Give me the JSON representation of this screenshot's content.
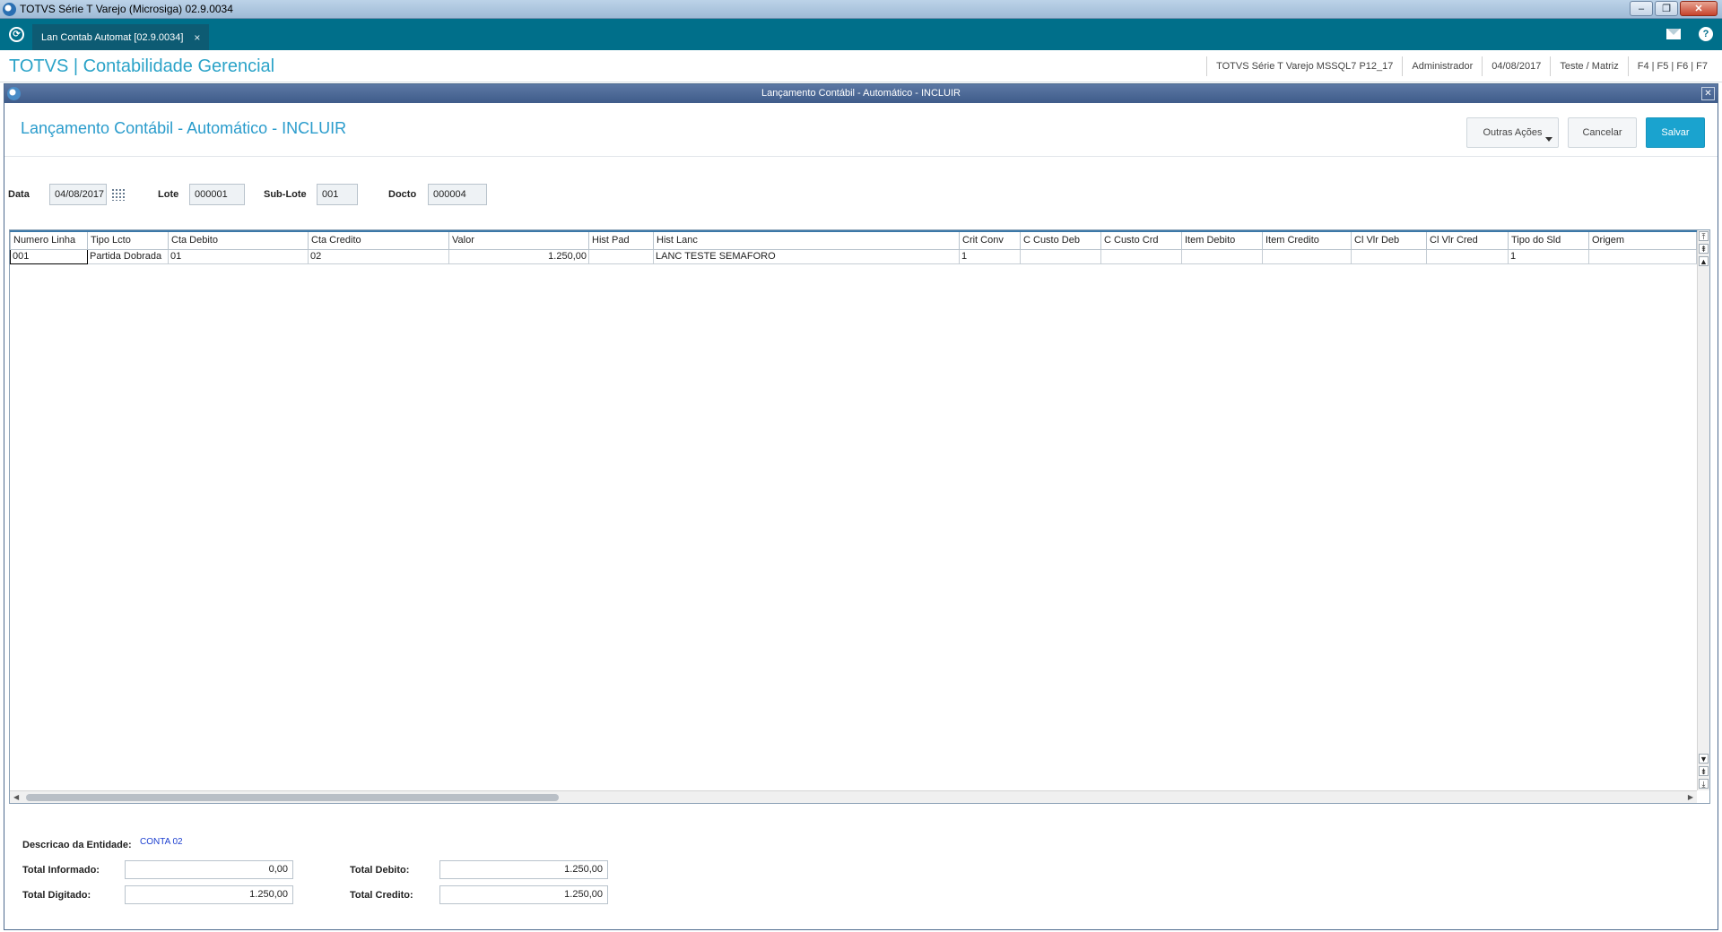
{
  "os": {
    "title": "TOTVS Série T Varejo (Microsiga) 02.9.0034",
    "minimize": "–",
    "restore": "❐",
    "close": "✕"
  },
  "tabbar": {
    "tab_label": "Lan Contab Automat [02.9.0034]",
    "tab_close": "×",
    "help": "?"
  },
  "header": {
    "brand": "TOTVS | Contabilidade Gerencial",
    "environment": "TOTVS Série T Varejo MSSQL7 P12_17",
    "user": "Administrador",
    "date": "04/08/2017",
    "company": "Teste / Matriz",
    "shortcuts": "F4 | F5 | F6 | F7"
  },
  "dialog": {
    "window_title": "Lançamento Contábil - Automático - INCLUIR",
    "close": "✕",
    "page_title": "Lançamento Contábil - Automático - INCLUIR",
    "buttons": {
      "outras": "Outras Ações",
      "cancelar": "Cancelar",
      "salvar": "Salvar"
    }
  },
  "form": {
    "data_label": "Data",
    "data_value": "04/08/2017",
    "lote_label": "Lote",
    "lote_value": "000001",
    "sublote_label": "Sub-Lote",
    "sublote_value": "001",
    "docto_label": "Docto",
    "docto_value": "000004"
  },
  "grid": {
    "columns": [
      "Numero Linha",
      "Tipo Lcto",
      "Cta Debito",
      "Cta Credito",
      "Valor",
      "Hist Pad",
      "Hist Lanc",
      "Crit Conv",
      "C Custo Deb",
      "C Custo Crd",
      "Item Debito",
      "Item Credito",
      "Cl Vlr Deb",
      "Cl Vlr Cred",
      "Tipo do Sld",
      "Origem"
    ],
    "rows": [
      [
        "001",
        "Partida Dobrada",
        "01",
        "02",
        "1.250,00",
        "",
        "LANC TESTE SEMAFORO",
        "1",
        "",
        "",
        "",
        "",
        "",
        "",
        "1",
        ""
      ]
    ]
  },
  "footer": {
    "entidade_label": "Descricao da Entidade:",
    "entidade_value": "CONTA 02",
    "total_informado_label": "Total Informado:",
    "total_informado_value": "0,00",
    "total_digitado_label": "Total Digitado:",
    "total_digitado_value": "1.250,00",
    "total_debito_label": "Total Debito:",
    "total_debito_value": "1.250,00",
    "total_credito_label": "Total Credito:",
    "total_credito_value": "1.250,00"
  }
}
